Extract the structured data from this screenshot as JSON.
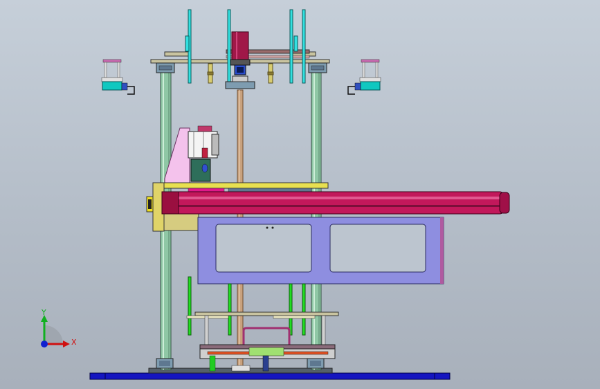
{
  "triad": {
    "y_label": "Y",
    "x_label": "X"
  },
  "colors": {
    "background": "#bcc5cf",
    "column": "#8fc7a5",
    "leadscrew": "#c9a27e",
    "frame_plate": "#c9c4a0",
    "linear_actuator": "#c2185b",
    "actuator_dark": "#7a0f3a",
    "carriage_plate": "#8e8ee0",
    "base_plate": "#1515c0",
    "cylinder_rod": "#33e0e0",
    "motor": "#a01848",
    "gripper_bracket": "#f4c2ec",
    "sensor": "#10a0a0",
    "guide_rod": "#22dd22",
    "bearing_block": "#7e9cb0",
    "brass": "#d8cc70"
  },
  "icons": [
    "coordinate-triad-icon"
  ]
}
